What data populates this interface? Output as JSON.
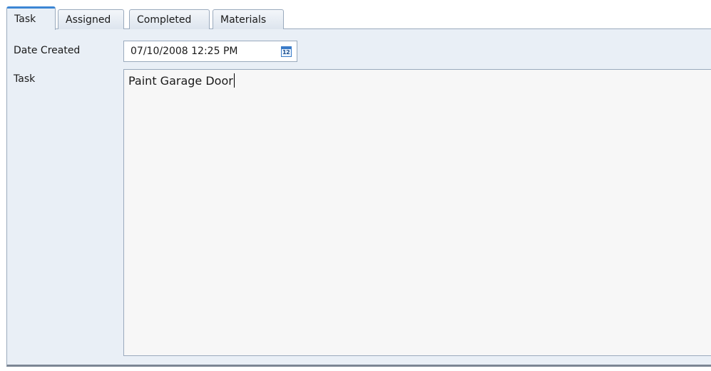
{
  "tabs": [
    {
      "label": "Task",
      "active": true
    },
    {
      "label": "Assigned",
      "active": false
    },
    {
      "label": "Completed",
      "active": false
    },
    {
      "label": "Materials",
      "active": false
    }
  ],
  "form": {
    "date_created_label": "Date Created",
    "date_created_value": "07/10/2008 12:25 PM",
    "calendar_icon_text": "12",
    "task_label": "Task",
    "task_value": "Paint Garage Door"
  },
  "colors": {
    "active_tab_accent": "#3c86d4",
    "panel_background": "#e9eff6",
    "border": "#9aaabd",
    "textarea_background": "#f7f7f7"
  },
  "icons": {
    "calendar_button": "calendar-icon"
  }
}
